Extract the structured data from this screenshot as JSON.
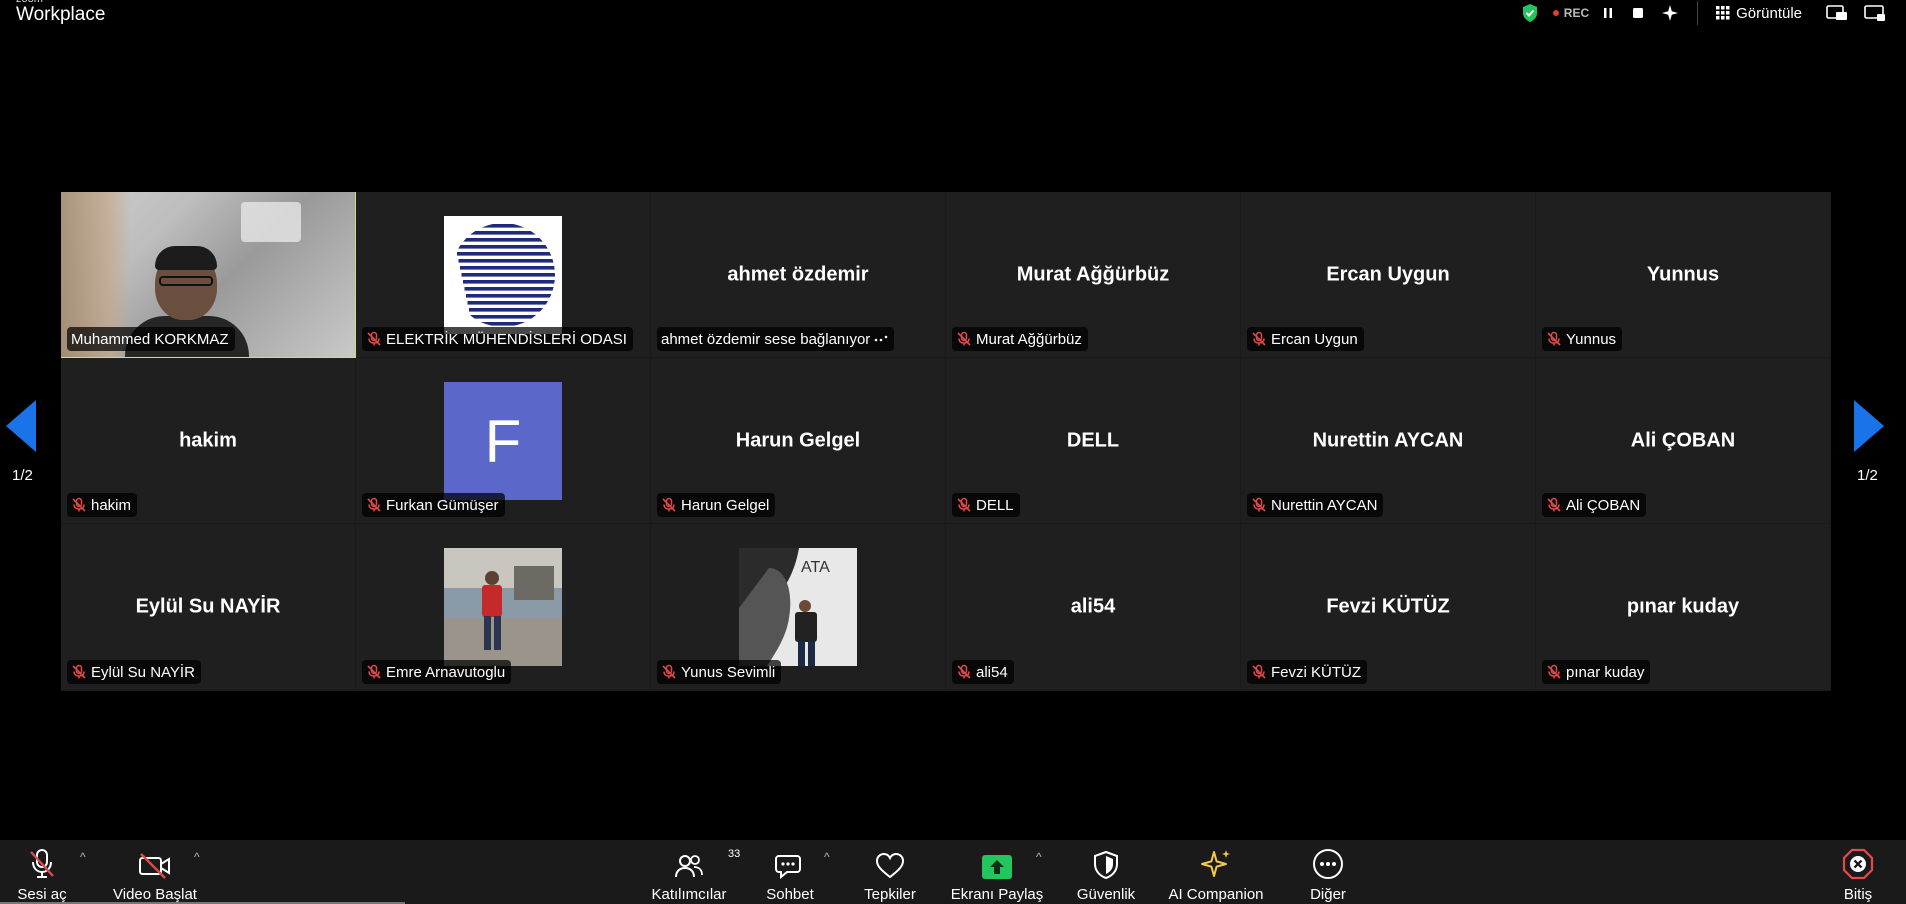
{
  "app": {
    "brand_small": "zoom",
    "brand": "Workplace"
  },
  "topbar": {
    "rec_label": "REC",
    "view_label": "Görüntüle"
  },
  "gallery": {
    "page_left": "1/2",
    "page_right": "1/2",
    "tiles": [
      {
        "big": "",
        "label": "Muhammed KORKMAZ",
        "muted": false,
        "type": "camera",
        "active": true
      },
      {
        "big": "",
        "label": "ELEKTRİK MÜHENDİSLERİ ODASI",
        "muted": true,
        "type": "logo"
      },
      {
        "big": "ahmet özdemir",
        "label": "ahmet özdemir sese bağlanıyor",
        "muted": false,
        "type": "connecting"
      },
      {
        "big": "Murat Ağğürbüz",
        "label": "Murat Ağğürbüz",
        "muted": true,
        "type": "name"
      },
      {
        "big": "Ercan Uygun",
        "label": "Ercan Uygun",
        "muted": true,
        "type": "name"
      },
      {
        "big": "Yunnus",
        "label": "Yunnus",
        "muted": true,
        "type": "name"
      },
      {
        "big": "hakim",
        "label": "hakim",
        "muted": true,
        "type": "name"
      },
      {
        "big": "F",
        "label": "Furkan Gümüşer",
        "muted": true,
        "type": "letter"
      },
      {
        "big": "Harun Gelgel",
        "label": "Harun Gelgel",
        "muted": true,
        "type": "name"
      },
      {
        "big": "DELL",
        "label": "DELL",
        "muted": true,
        "type": "name"
      },
      {
        "big": "Nurettin AYCAN",
        "label": "Nurettin AYCAN",
        "muted": true,
        "type": "name"
      },
      {
        "big": "Ali ÇOBAN",
        "label": "Ali ÇOBAN",
        "muted": true,
        "type": "name"
      },
      {
        "big": "Eylül Su NAYİR",
        "label": "Eylül Su NAYİR",
        "muted": true,
        "type": "name"
      },
      {
        "big": "",
        "label": "Emre Arnavutoglu",
        "muted": true,
        "type": "photo-emre"
      },
      {
        "big": "",
        "label": "Yunus Sevimli",
        "muted": true,
        "type": "photo-yunus"
      },
      {
        "big": "ali54",
        "label": "ali54",
        "muted": true,
        "type": "name"
      },
      {
        "big": "Fevzi KÜTÜZ",
        "label": "Fevzi KÜTÜZ",
        "muted": true,
        "type": "name"
      },
      {
        "big": "pınar kuday",
        "label": "pınar kuday",
        "muted": true,
        "type": "name"
      }
    ]
  },
  "toolbar": {
    "unmute": "Sesi aç",
    "start_video": "Video Başlat",
    "participants": "Katılımcılar",
    "participants_count": "33",
    "chat": "Sohbet",
    "reactions": "Tepkiler",
    "share": "Ekranı Paylaş",
    "security": "Güvenlik",
    "ai": "AI Companion",
    "more": "Diğer",
    "end": "Bitiş"
  },
  "colors": {
    "active_border": "#c9e07a",
    "share_green": "#22c55e",
    "nav_blue": "#1a73e8",
    "muted_red": "#e04a4a",
    "end_red": "#e5484d",
    "ai_yellow": "#f2c94c",
    "shield_green": "#22c55e",
    "letter_avatar": "#5b68c9"
  }
}
